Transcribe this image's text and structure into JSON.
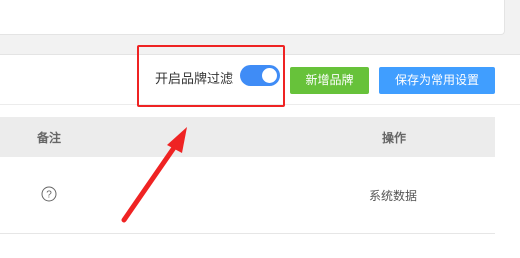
{
  "toolbar": {
    "filter_label": "开启品牌过滤",
    "filter_enabled": true,
    "add_brand_label": "新增品牌",
    "save_default_label": "保存为常用设置"
  },
  "table": {
    "columns": [
      "备注",
      "操作"
    ],
    "rows": [
      {
        "remark_icon": "question-circle-icon",
        "action": "系统数据"
      }
    ]
  },
  "annotation": {
    "highlight_color": "#ef2323",
    "arrow_color": "#ef2323"
  },
  "colors": {
    "toggle_on": "#3f8cf6",
    "add_button": "#67c23a",
    "save_button": "#409eff"
  }
}
